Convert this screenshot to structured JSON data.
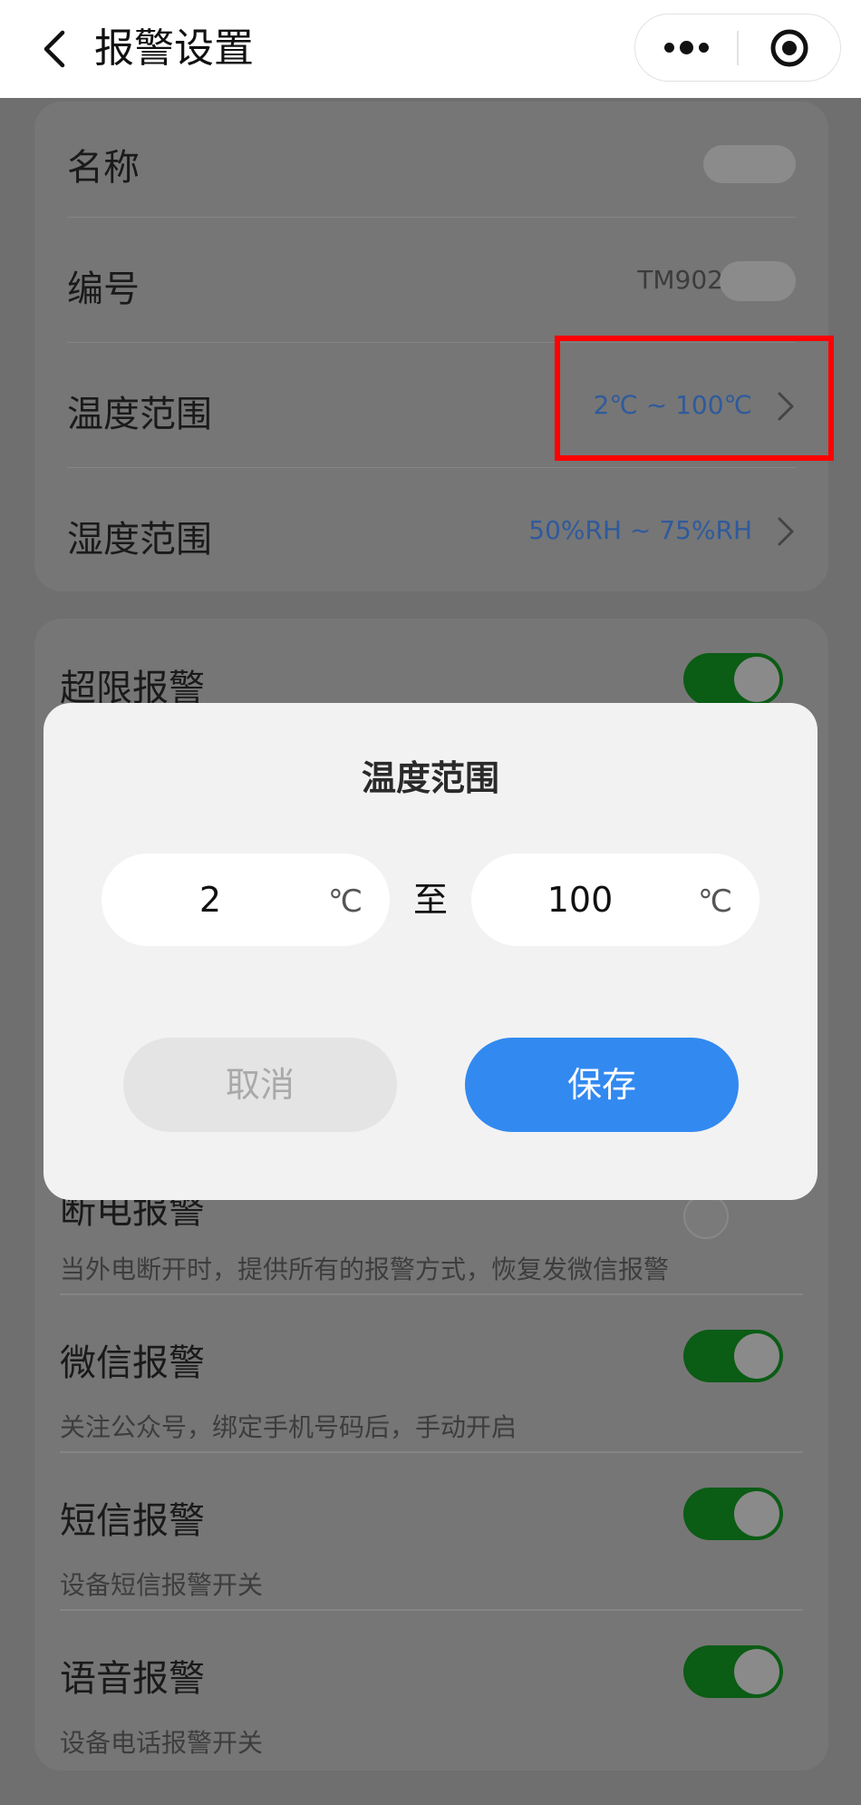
{
  "navbar": {
    "title": "报警设置",
    "back_icon": "chevron-left-icon",
    "more_icon": "more-dots-icon",
    "close_icon": "target-circle-icon"
  },
  "device_card": {
    "rows": [
      {
        "label": "名称",
        "value": ""
      },
      {
        "label": "编号",
        "value": "TM902"
      },
      {
        "label": "温度范围",
        "value": "2℃ ~ 100℃"
      },
      {
        "label": "湿度范围",
        "value": "50%RH ~ 75%RH"
      }
    ]
  },
  "alarm_card": {
    "items": [
      {
        "label": "超限报警",
        "desc": "",
        "enabled": true
      },
      {
        "label": "断电报警",
        "desc": "当外电断开时，提供所有的报警方式，恢复发微信报警",
        "enabled": false
      },
      {
        "label": "微信报警",
        "desc": "关注公众号，绑定手机号码后，手动开启",
        "enabled": true
      },
      {
        "label": "短信报警",
        "desc": "设备短信报警开关",
        "enabled": true
      },
      {
        "label": "语音报警",
        "desc": "设备电话报警开关",
        "enabled": true
      }
    ]
  },
  "modal": {
    "title": "温度范围",
    "min_value": "2",
    "max_value": "100",
    "unit": "℃",
    "separator": "至",
    "cancel_label": "取消",
    "save_label": "保存"
  },
  "colors": {
    "save_button": "#3289f0",
    "toggle_on": "#0b5c15",
    "link_value": "#2f5a9c",
    "highlight_box": "#ff0000"
  }
}
